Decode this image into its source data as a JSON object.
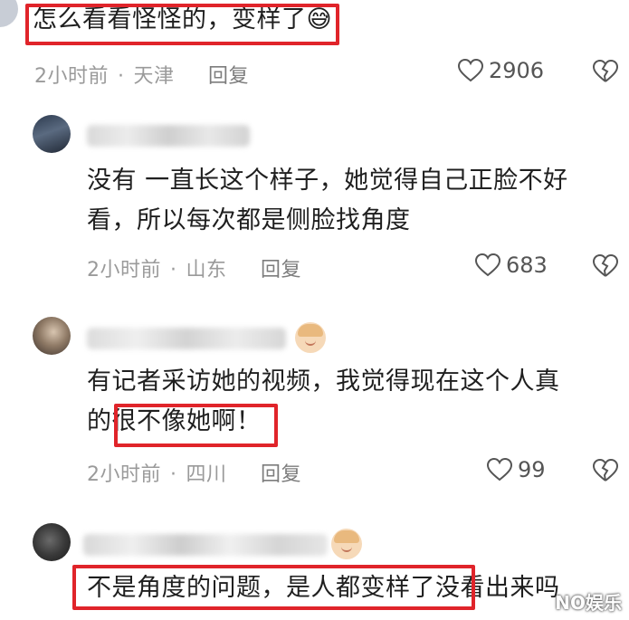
{
  "comments": [
    {
      "text": "怎么看看怪怪的，变样了😅",
      "time": "2小时前",
      "location": "天津",
      "reply": "回复",
      "likes": "2906"
    },
    {
      "text_lines": [
        "没有 一直长这个样子，她觉得自己正脸不好",
        "看，所以每次都是侧脸找角度"
      ],
      "time": "2小时前",
      "location": "山东",
      "reply": "回复",
      "likes": "683"
    },
    {
      "text_line1": "有记者采访她的视频，我觉得现在这个人真",
      "text_line2_prefix": "的",
      "text_line2_highlight": "很不像她啊！",
      "time": "2小时前",
      "location": "四川",
      "reply": "回复",
      "likes": "99"
    },
    {
      "text_highlight": "不是角度的问题，是人都变样了",
      "text_rest": "没看出来吗"
    }
  ],
  "separator": "·",
  "watermark": "NO娱乐",
  "icons": {
    "like": "heart-outline-icon",
    "dislike": "broken-heart-icon"
  },
  "colors": {
    "highlight_box": "#e0242a",
    "meta_text": "#9a9a9a"
  }
}
